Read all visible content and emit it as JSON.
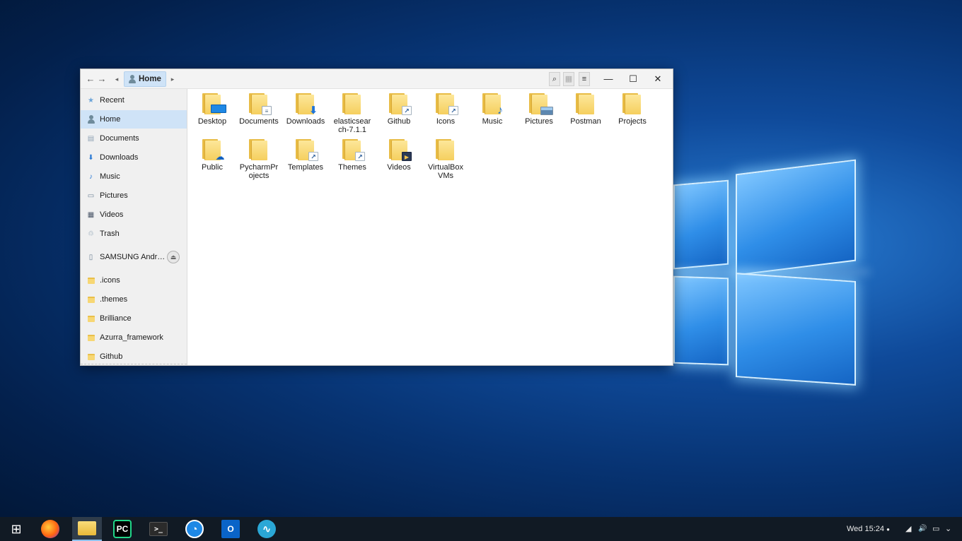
{
  "titlebar": {
    "breadcrumb": "Home",
    "buttons": {
      "back": "←",
      "forward": "→",
      "crumb_left": "◂",
      "crumb_right": "▸",
      "search": "⌕",
      "icon_view": "▦",
      "menu": "≡",
      "minimize": "—",
      "maximize": "☐",
      "close": "✕"
    }
  },
  "sidebar": {
    "places": [
      {
        "label": "Recent",
        "icon": "★"
      },
      {
        "label": "Home",
        "icon": "person"
      },
      {
        "label": "Documents",
        "icon": "▤"
      },
      {
        "label": "Downloads",
        "icon": "⬇"
      },
      {
        "label": "Music",
        "icon": "♪"
      },
      {
        "label": "Pictures",
        "icon": "▭"
      },
      {
        "label": "Videos",
        "icon": "▦"
      },
      {
        "label": "Trash",
        "icon": "♲"
      }
    ],
    "device": {
      "label": "SAMSUNG Andr…",
      "eject": "⏏"
    },
    "bookmarks": [
      ".icons",
      ".themes",
      "Brilliance",
      "Azurra_framework",
      "Github"
    ]
  },
  "files": [
    {
      "name": "Desktop",
      "badge": ""
    },
    {
      "name": "Documents",
      "badge": "≡"
    },
    {
      "name": "Downloads",
      "badge": "⬇"
    },
    {
      "name": "elasticsearch-7.1.1",
      "line1": "elasticsear",
      "line2": "ch-7.1.1",
      "badge": ""
    },
    {
      "name": "Github",
      "badge": "↗"
    },
    {
      "name": "Icons",
      "badge": "↗"
    },
    {
      "name": "Music",
      "badge": "♪"
    },
    {
      "name": "Pictures",
      "badge": ""
    },
    {
      "name": "Postman",
      "badge": ""
    },
    {
      "name": "Projects",
      "badge": ""
    },
    {
      "name": "Public",
      "badge": "☁"
    },
    {
      "name": "PycharmProjects",
      "line1": "PycharmPr",
      "line2": "ojects",
      "badge": ""
    },
    {
      "name": "Templates",
      "badge": "↗"
    },
    {
      "name": "Themes",
      "badge": "↗"
    },
    {
      "name": "Videos",
      "badge": "▶"
    },
    {
      "name": "VirtualBox VMs",
      "line1": "VirtualBox",
      "line2": "VMs",
      "badge": ""
    }
  ],
  "taskbar": {
    "start": "⊞",
    "apps": [
      {
        "name": "firefox",
        "glyph": ""
      },
      {
        "name": "files",
        "glyph": ""
      },
      {
        "name": "pycharm",
        "glyph": "PC"
      },
      {
        "name": "terminal",
        "glyph": ">_"
      },
      {
        "name": "timer",
        "glyph": "◔"
      },
      {
        "name": "outlook",
        "glyph": "O"
      },
      {
        "name": "audio",
        "glyph": "∿"
      }
    ],
    "clock": "Wed 15:24",
    "clock_dot": "●",
    "tray": {
      "network": "◢",
      "volume": "🔊",
      "battery": "▭",
      "expand": "⌄"
    }
  },
  "colors": {
    "accent": "#cfe3f7",
    "folder": "#f5cf5e",
    "taskbar": "#111a24"
  }
}
